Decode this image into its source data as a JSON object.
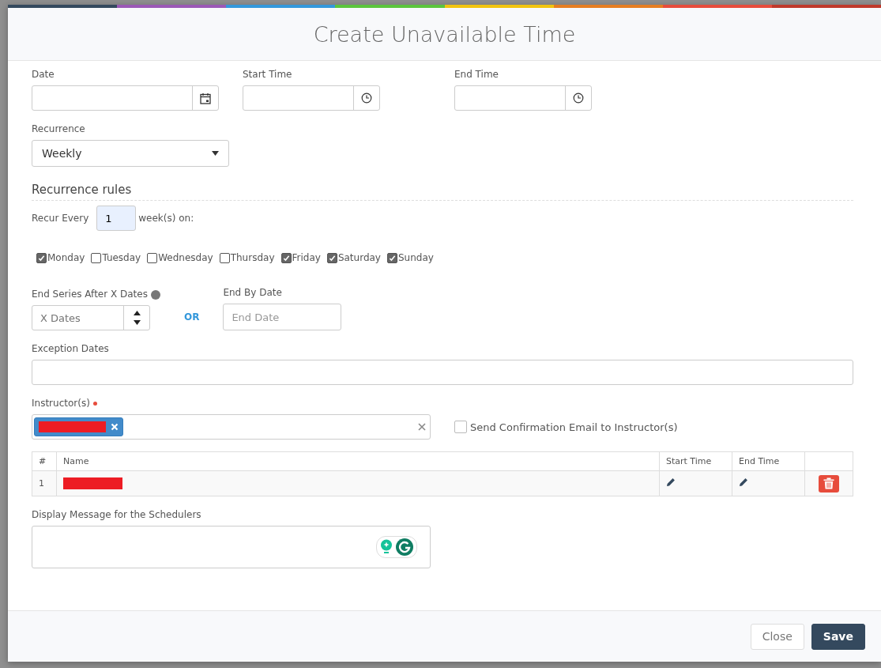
{
  "modal": {
    "title": "Create Unavailable Time"
  },
  "fields": [
    {
      "label": "Date",
      "kind": "date"
    },
    {
      "label": "Start Time",
      "kind": "time"
    },
    {
      "label": "End Time",
      "kind": "time"
    }
  ],
  "recurrence": {
    "label": "Recurrence",
    "value": "Weekly"
  },
  "rules": {
    "title": "Recurrence rules",
    "recur_label": "Recur Every",
    "recur_value": "1",
    "recur_suffix": "week(s) on:",
    "days": [
      {
        "label": "Monday",
        "checked": true
      },
      {
        "label": "Tuesday",
        "checked": false
      },
      {
        "label": "Wednesday",
        "checked": false
      },
      {
        "label": "Thursday",
        "checked": false
      },
      {
        "label": "Friday",
        "checked": true
      },
      {
        "label": "Saturday",
        "checked": true
      },
      {
        "label": "Sunday",
        "checked": true
      }
    ],
    "end_after_label": "End Series After X Dates",
    "end_after_placeholder": "X Dates",
    "or": "OR",
    "end_by_label": "End By Date",
    "end_by_placeholder": "End Date"
  },
  "exception": {
    "label": "Exception Dates"
  },
  "instructors": {
    "label": "Instructor(s)",
    "required": true,
    "chips": [
      {
        "kind": "redacted"
      }
    ],
    "send_email": {
      "label": "Send Confirmation Email to Instructor(s)",
      "checked": false
    }
  },
  "table": {
    "columns": [
      "#",
      "Name",
      "Start Time",
      "End Time"
    ],
    "rows": [
      {
        "number": "1"
      }
    ]
  },
  "message": {
    "label": "Display Message for the Schedulers"
  },
  "buttons": [
    {
      "label": "Close",
      "kind": "secondary"
    },
    {
      "label": "Save",
      "kind": "primary"
    }
  ]
}
